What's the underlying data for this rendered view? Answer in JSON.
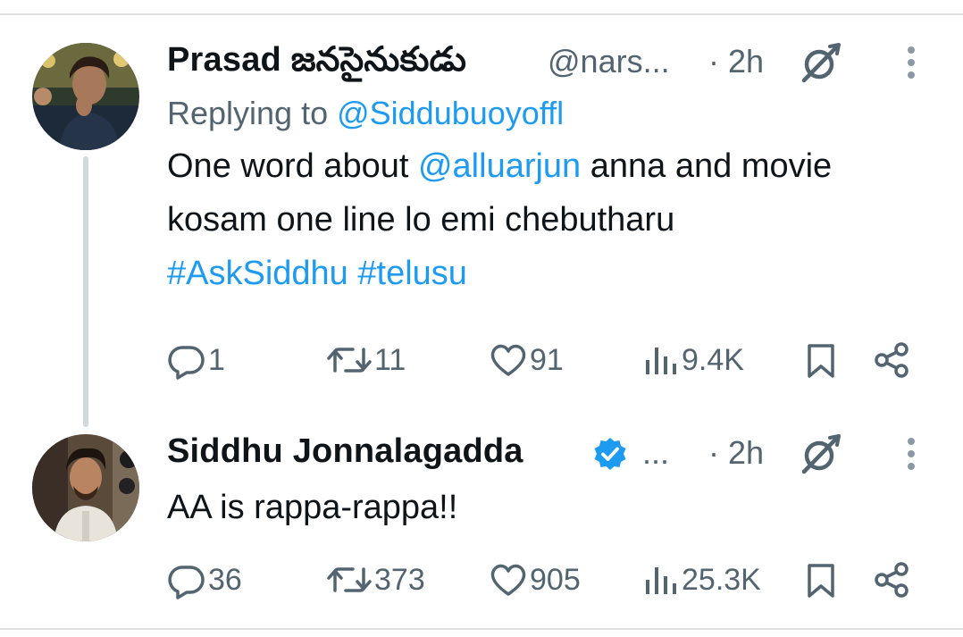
{
  "colors": {
    "link": "#1d9bf0",
    "secondary_text": "#536471",
    "primary_text": "#0f1419",
    "thread_line": "#cfd9de",
    "verified_badge": "#1d9bf0"
  },
  "tweets": [
    {
      "author_name": "Prasad జనసైనుకుడు",
      "handle": "@nars...",
      "time": "· 2h",
      "replying_prefix": "Replying to ",
      "replying_to": "@Siddubuoyoffl",
      "body_part1": "One word about ",
      "mention": "@alluarjun",
      "body_part2": " anna and movie kosam one line lo emi chebutharu",
      "hashtag1": "#AskSiddhu",
      "hashtag2": "#telusu",
      "stats": {
        "replies": "1",
        "reposts": "11",
        "likes": "91",
        "views": "9.4K"
      }
    },
    {
      "author_name": "Siddhu Jonnalagadda",
      "handle": "...",
      "verified": true,
      "time": "· 2h",
      "body": "AA is rappa-rappa!!",
      "stats": {
        "replies": "36",
        "reposts": "373",
        "likes": "905",
        "views": "25.3K"
      }
    }
  ],
  "icons": {
    "grok": "grok-icon",
    "more": "more-vertical-icon",
    "reply": "reply-icon",
    "repost": "repost-icon",
    "like": "heart-icon",
    "views": "views-icon",
    "bookmark": "bookmark-icon",
    "share": "share-icon",
    "verified": "verified-badge-icon"
  }
}
